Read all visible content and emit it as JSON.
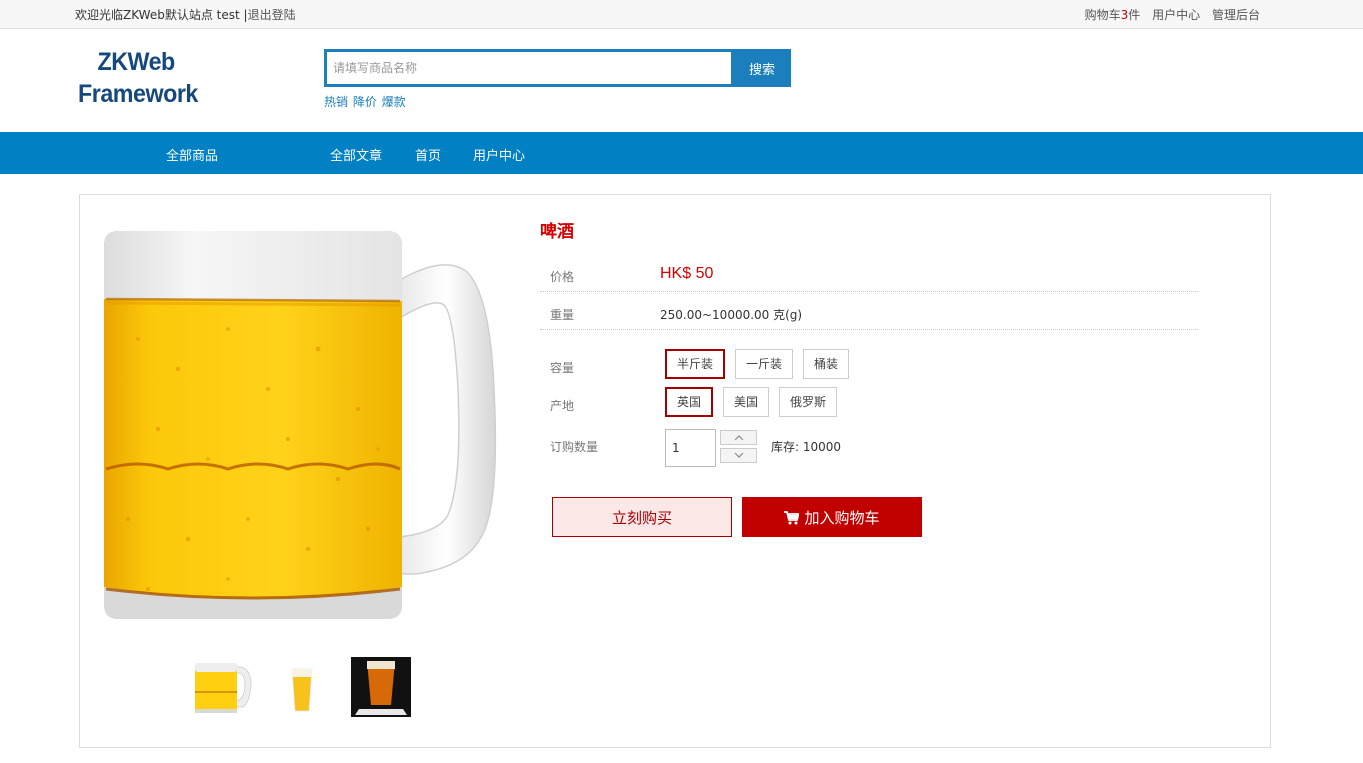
{
  "topbar": {
    "welcome": "欢迎光临ZKWeb默认站点",
    "username": "test",
    "separator": "|",
    "logout": "退出登陆",
    "cart_prefix": "购物车",
    "cart_count": "3",
    "cart_suffix": "件",
    "user_center": "用户中心",
    "admin": "管理后台"
  },
  "logo": {
    "line1": "ZKWeb",
    "line2": "Framework",
    "color": "#14487e"
  },
  "search": {
    "placeholder": "请填写商品名称",
    "button": "搜索",
    "hot_links": [
      "热销",
      "降价",
      "爆款"
    ]
  },
  "nav": {
    "items": [
      "全部商品",
      "全部文章",
      "首页",
      "用户中心"
    ],
    "background": "#0181c3"
  },
  "product": {
    "title": "啤酒",
    "price_label": "价格",
    "price": "HK$ 50",
    "weight_label": "重量",
    "weight": "250.00~10000.00 克(g)",
    "capacity_label": "容量",
    "capacity_options": [
      "半斤装",
      "一斤装",
      "桶装"
    ],
    "capacity_selected": "半斤装",
    "origin_label": "产地",
    "origin_options": [
      "英国",
      "美国",
      "俄罗斯"
    ],
    "origin_selected": "英国",
    "quantity_label": "订购数量",
    "quantity": "1",
    "stock": "库存: 10000",
    "buy_now": "立刻购买",
    "add_cart": "加入购物车",
    "accent": "#d50000"
  },
  "gallery": {
    "thumbnails": [
      "beer-mug",
      "beer-glass",
      "dark-beer-glass"
    ]
  }
}
